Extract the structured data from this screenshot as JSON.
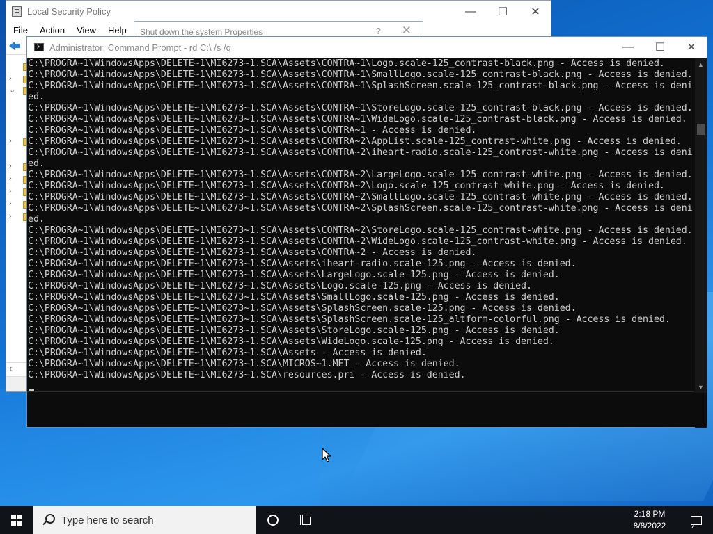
{
  "lsp_window": {
    "title": "Local Security Policy",
    "menu": [
      "File",
      "Action",
      "View",
      "Help"
    ]
  },
  "props_dialog": {
    "title": "Shut down the system Properties",
    "help_glyph": "?"
  },
  "cmd_window": {
    "title": "Administrator: Command Prompt - rd  C:\\ /s /q",
    "lines": [
      "C:\\PROGRA~1\\WindowsApps\\DELETE~1\\MI6273~1.SCA\\Assets\\CONTRA~1\\Logo.scale-125_contrast-black.png - Access is denied.",
      "C:\\PROGRA~1\\WindowsApps\\DELETE~1\\MI6273~1.SCA\\Assets\\CONTRA~1\\SmallLogo.scale-125_contrast-black.png - Access is denied.",
      "C:\\PROGRA~1\\WindowsApps\\DELETE~1\\MI6273~1.SCA\\Assets\\CONTRA~1\\SplashScreen.scale-125_contrast-black.png - Access is deni",
      "ed.",
      "C:\\PROGRA~1\\WindowsApps\\DELETE~1\\MI6273~1.SCA\\Assets\\CONTRA~1\\StoreLogo.scale-125_contrast-black.png - Access is denied.",
      "C:\\PROGRA~1\\WindowsApps\\DELETE~1\\MI6273~1.SCA\\Assets\\CONTRA~1\\WideLogo.scale-125_contrast-black.png - Access is denied.",
      "C:\\PROGRA~1\\WindowsApps\\DELETE~1\\MI6273~1.SCA\\Assets\\CONTRA~1 - Access is denied.",
      "C:\\PROGRA~1\\WindowsApps\\DELETE~1\\MI6273~1.SCA\\Assets\\CONTRA~2\\AppList.scale-125_contrast-white.png - Access is denied.",
      "C:\\PROGRA~1\\WindowsApps\\DELETE~1\\MI6273~1.SCA\\Assets\\CONTRA~2\\iheart-radio.scale-125_contrast-white.png - Access is deni",
      "ed.",
      "C:\\PROGRA~1\\WindowsApps\\DELETE~1\\MI6273~1.SCA\\Assets\\CONTRA~2\\LargeLogo.scale-125_contrast-white.png - Access is denied.",
      "C:\\PROGRA~1\\WindowsApps\\DELETE~1\\MI6273~1.SCA\\Assets\\CONTRA~2\\Logo.scale-125_contrast-white.png - Access is denied.",
      "C:\\PROGRA~1\\WindowsApps\\DELETE~1\\MI6273~1.SCA\\Assets\\CONTRA~2\\SmallLogo.scale-125_contrast-white.png - Access is denied.",
      "C:\\PROGRA~1\\WindowsApps\\DELETE~1\\MI6273~1.SCA\\Assets\\CONTRA~2\\SplashScreen.scale-125_contrast-white.png - Access is deni",
      "ed.",
      "C:\\PROGRA~1\\WindowsApps\\DELETE~1\\MI6273~1.SCA\\Assets\\CONTRA~2\\StoreLogo.scale-125_contrast-white.png - Access is denied.",
      "C:\\PROGRA~1\\WindowsApps\\DELETE~1\\MI6273~1.SCA\\Assets\\CONTRA~2\\WideLogo.scale-125_contrast-white.png - Access is denied.",
      "C:\\PROGRA~1\\WindowsApps\\DELETE~1\\MI6273~1.SCA\\Assets\\CONTRA~2 - Access is denied.",
      "C:\\PROGRA~1\\WindowsApps\\DELETE~1\\MI6273~1.SCA\\Assets\\iheart-radio.scale-125.png - Access is denied.",
      "C:\\PROGRA~1\\WindowsApps\\DELETE~1\\MI6273~1.SCA\\Assets\\LargeLogo.scale-125.png - Access is denied.",
      "C:\\PROGRA~1\\WindowsApps\\DELETE~1\\MI6273~1.SCA\\Assets\\Logo.scale-125.png - Access is denied.",
      "C:\\PROGRA~1\\WindowsApps\\DELETE~1\\MI6273~1.SCA\\Assets\\SmallLogo.scale-125.png - Access is denied.",
      "C:\\PROGRA~1\\WindowsApps\\DELETE~1\\MI6273~1.SCA\\Assets\\SplashScreen.scale-125.png - Access is denied.",
      "C:\\PROGRA~1\\WindowsApps\\DELETE~1\\MI6273~1.SCA\\Assets\\SplashScreen.scale-125_altform-colorful.png - Access is denied.",
      "C:\\PROGRA~1\\WindowsApps\\DELETE~1\\MI6273~1.SCA\\Assets\\StoreLogo.scale-125.png - Access is denied.",
      "C:\\PROGRA~1\\WindowsApps\\DELETE~1\\MI6273~1.SCA\\Assets\\WideLogo.scale-125.png - Access is denied.",
      "C:\\PROGRA~1\\WindowsApps\\DELETE~1\\MI6273~1.SCA\\Assets - Access is denied.",
      "C:\\PROGRA~1\\WindowsApps\\DELETE~1\\MI6273~1.SCA\\MICROS~1.MET - Access is denied.",
      "C:\\PROGRA~1\\WindowsApps\\DELETE~1\\MI6273~1.SCA\\resources.pri - Access is denied."
    ]
  },
  "taskbar": {
    "search_placeholder": "Type here to search",
    "time": "2:18 PM",
    "date": "8/8/2022"
  },
  "icons": {
    "start": "windows-logo-icon",
    "search": "search-icon",
    "cortana": "cortana-circle-icon",
    "task_view": "task-view-icon",
    "notifications": "notification-icon"
  },
  "colors": {
    "console_bg": "#0c0c0c",
    "console_text": "#cccccc",
    "taskbar_bg": "#101318",
    "desktop_accent": "#1273d4"
  }
}
